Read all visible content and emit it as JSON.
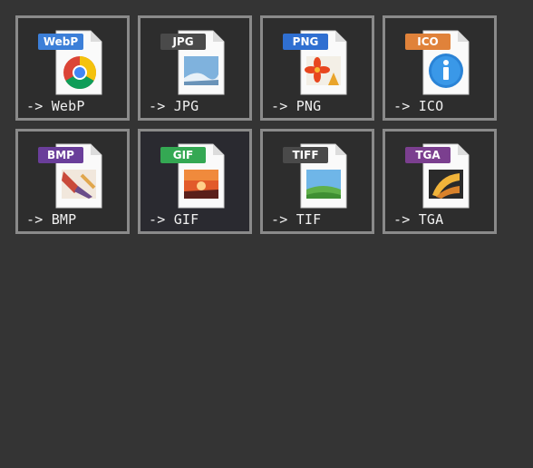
{
  "tiles": [
    {
      "label": "-> WebP",
      "badge": "WebP",
      "badge_color": "#3c7fd8",
      "icon": "webp-chrome-icon"
    },
    {
      "label": "-> JPG",
      "badge": "JPG",
      "badge_color": "#4a4a4a",
      "icon": "jpg-photo-icon"
    },
    {
      "label": "-> PNG",
      "badge": "PNG",
      "badge_color": "#2f6fd1",
      "icon": "png-flower-icon"
    },
    {
      "label": "-> ICO",
      "badge": "ICO",
      "badge_color": "#e0823a",
      "icon": "ico-info-icon"
    },
    {
      "label": "-> BMP",
      "badge": "BMP",
      "badge_color": "#6a3e9a",
      "icon": "bmp-paint-icon"
    },
    {
      "label": "-> GIF",
      "badge": "GIF",
      "badge_color": "#34a853",
      "icon": "gif-sunset-icon"
    },
    {
      "label": "-> TIF",
      "badge": "TIFF",
      "badge_color": "#4a4a4a",
      "icon": "tiff-landscape-icon"
    },
    {
      "label": "-> TGA",
      "badge": "TGA",
      "badge_color": "#7b3f8f",
      "icon": "tga-photo-icon"
    }
  ]
}
